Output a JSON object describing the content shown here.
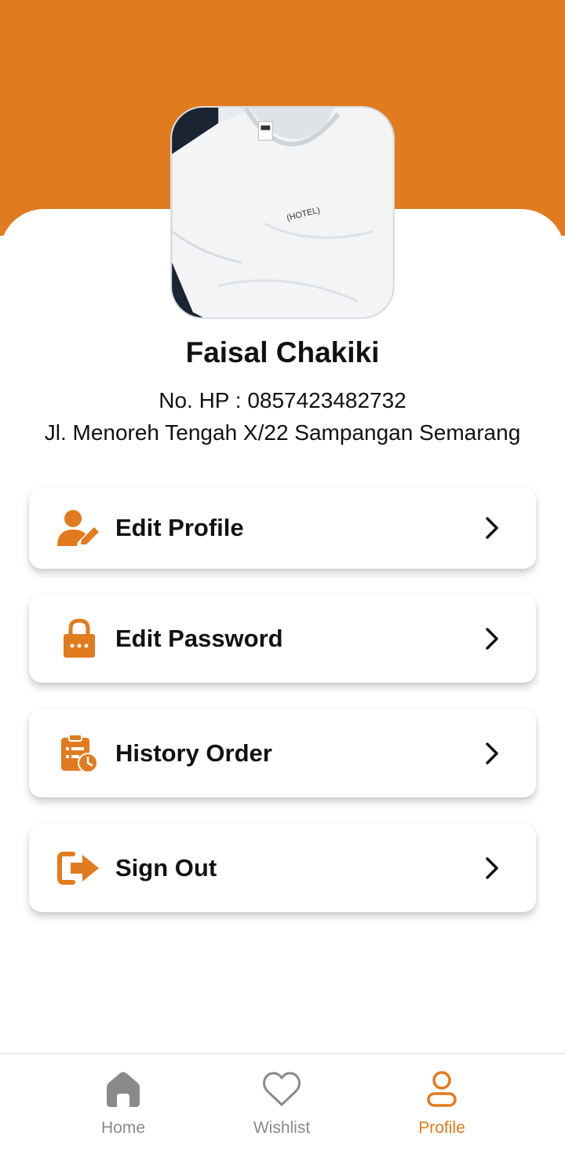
{
  "colors": {
    "accent": "#e07b1f",
    "inactive": "#8a8a8a",
    "text": "#111111"
  },
  "profile": {
    "name": "Faisal Chakiki",
    "phone": "No. HP : 0857423482732",
    "address": "Jl. Menoreh Tengah X/22 Sampangan Semarang",
    "photo_icon": "tshirt-photo",
    "photo_text": "(HOTEL)"
  },
  "menu": {
    "items": [
      {
        "label": "Edit Profile",
        "icon": "user-edit-icon"
      },
      {
        "label": "Edit Password",
        "icon": "lock-icon"
      },
      {
        "label": "History Order",
        "icon": "clipboard-clock-icon"
      },
      {
        "label": "Sign Out",
        "icon": "sign-out-icon"
      }
    ]
  },
  "nav": {
    "items": [
      {
        "label": "Home",
        "icon": "home-icon",
        "active": false
      },
      {
        "label": "Wishlist",
        "icon": "heart-icon",
        "active": false
      },
      {
        "label": "Profile",
        "icon": "user-icon",
        "active": true
      }
    ]
  }
}
